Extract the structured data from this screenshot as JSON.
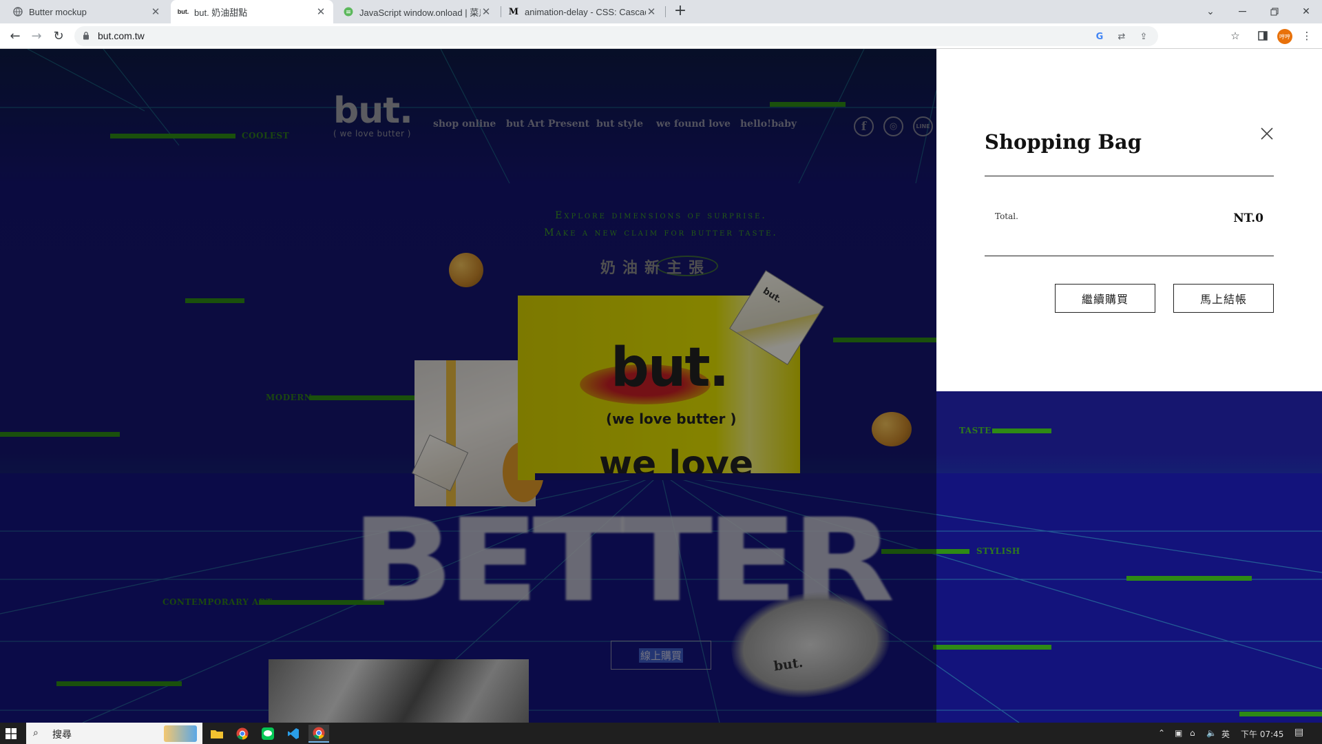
{
  "browser": {
    "tabs": [
      {
        "title": "Butter mockup",
        "favicon": "globe-icon",
        "active": false
      },
      {
        "title": "but. 奶油甜點",
        "favicon_text": "but.",
        "active": true
      },
      {
        "title": "JavaScript window.onload | 菜鳥",
        "favicon": "green-circle-icon",
        "active": false
      },
      {
        "title": "animation-delay - CSS: Cascad",
        "favicon_text": "M",
        "active": false
      }
    ],
    "url": "but.com.tw",
    "profile_label": "哼哼"
  },
  "site": {
    "logo": {
      "main": "but.",
      "sub": "( we love butter )"
    },
    "nav": [
      "shop online",
      "but Art Present",
      "but style",
      "we found love",
      "hello!baby"
    ],
    "social": [
      {
        "icon": "facebook-icon",
        "glyph": "f"
      },
      {
        "icon": "instagram-icon",
        "glyph": "◎"
      },
      {
        "icon": "line-icon",
        "glyph": "LINE"
      }
    ],
    "tagline_1": "Explore dimensions of surprise.",
    "tagline_2": "Make a new claim for  butter taste.",
    "cn_tagline": "奶油新主張",
    "labels": {
      "coolest": "COOLEST",
      "modern": "MODERN",
      "taste": "TASTE",
      "stylish": "STYLISH",
      "contemporary_art": "CONTEMPORARY ART"
    },
    "card": {
      "logo": "but.",
      "sub": "(we love butter )",
      "headline": "we love"
    },
    "big_word": "BETTER",
    "buy_button": "線上購買",
    "package_label_1": "but.",
    "package_label_2": "but."
  },
  "cart": {
    "title": "Shopping Bag",
    "total_label": "Total.",
    "total_value": "NT.0",
    "continue_button": "繼續購買",
    "checkout_button": "馬上結帳"
  },
  "taskbar": {
    "search_placeholder": "搜尋",
    "ime": "英",
    "time": "下午 07:45"
  }
}
